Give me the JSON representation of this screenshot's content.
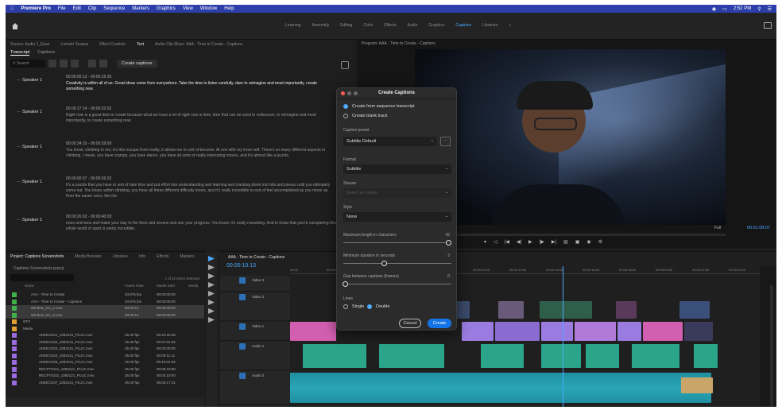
{
  "menubar": {
    "app": "Premiere Pro",
    "items": [
      "File",
      "Edit",
      "Clip",
      "Sequence",
      "Markers",
      "Graphics",
      "View",
      "Window",
      "Help"
    ],
    "clock": "2:52 PM"
  },
  "workspaces": {
    "tabs": [
      "Learning",
      "Assembly",
      "Editing",
      "Color",
      "Effects",
      "Audio",
      "Graphics",
      "Captions",
      "Libraries"
    ],
    "active": "Captions"
  },
  "left_panel": {
    "tabs": [
      "Source: Audio 1_Ease",
      "Lumetri Scopes",
      "Effect Controls",
      "Text",
      "Audio Clip Mixer: AAA - Time to Create - Captions"
    ],
    "active_tab": "Text",
    "subtabs": [
      "Transcript",
      "Captions"
    ],
    "active_subtab": "Transcript",
    "search_placeholder": "Search",
    "create_captions_label": "Create captions",
    "transcript": [
      {
        "speaker": "Speaker 1",
        "timecode": "00:00:00:13 - 00:00:15:20",
        "text": "Creativity is within all of us. Great ideas come from everywhere. Take the time to listen carefully, dare to reimagine and most importantly, create something new.",
        "highlight": true
      },
      {
        "speaker": "Speaker 1",
        "timecode": "00:00:17:14 - 00:00:32:02",
        "text": "Right now is a great time to create because what we have a lot of right now is time; time that can be used to rediscover, to reimagine and most importantly, to create something new.",
        "highlight": false
      },
      {
        "speaker": "Speaker 1",
        "timecode": "00:00:34:10 - 00:00:39:09",
        "text": "You know, climbing to me, it's this escape from reality, it allows me to sort of become. At one with my inner self. There's so many different aspects to climbing. I mean, you have cramps, you have dance, you have all sorts of really interesting moves, and it's almost like a puzzle.",
        "highlight": false
      },
      {
        "speaker": "Speaker 1",
        "timecode": "00:00:00:07 - 00:00:26:02",
        "text": "It's a puzzle that you have to sort of take time and put effort into understanding and learning and cracking down into bits and pieces until you ultimately come out. You know, within climbing, you have all these different difficulty levels, and it's really incredible to sort of feel accomplished as you move up from the easier ones, like the",
        "highlight": false
      },
      {
        "speaker": "Speaker 1",
        "timecode": "00:00:26:02 - 00:00:40:03",
        "text": "ones and twos and make your way to the fives and sevens and see your progress. You know, it's really rewarding. And to know that you're conquering this whole world of sport is pretty incredible.",
        "highlight": false
      }
    ]
  },
  "program": {
    "title": "Program: AAA - Time to Create - Captions",
    "fit": "Full",
    "timecode": "00:01:08:07"
  },
  "dialog": {
    "title": "Create Captions",
    "source_options": [
      {
        "label": "Create from sequence transcript",
        "selected": true
      },
      {
        "label": "Create blank track",
        "selected": false
      }
    ],
    "caption_preset_label": "Caption preset",
    "caption_preset_value": "Subtitle Default",
    "format_label": "Format",
    "format_value": "Subtitle",
    "stream_label": "Stream",
    "stream_value": "Select an option",
    "style_label": "Style",
    "style_value": "None",
    "max_length_label": "Maximum length in characters",
    "max_length_value": "42",
    "min_duration_label": "Minimum duration in seconds",
    "min_duration_value": "3",
    "gap_label": "Gap between captions (frames)",
    "gap_value": "0",
    "lines_label": "Lines",
    "lines_options": [
      {
        "label": "Single",
        "selected": false
      },
      {
        "label": "Double",
        "selected": true
      }
    ],
    "cancel_label": "Cancel",
    "create_label": "Create"
  },
  "project": {
    "tabs": [
      "Project: Captions Screenshots",
      "Media Browser",
      "Libraries",
      "Info",
      "Effects",
      "Markers"
    ],
    "file": "Captions Screenshots.prproj",
    "items_count": "1 of 11 items selected",
    "columns": [
      "Name",
      "Frame Rate",
      "Media Start",
      "Media"
    ],
    "rows": [
      {
        "name": "AAA - Time to Create",
        "fr": "23.976 fps",
        "start": "00:00:00:00",
        "color": "#3fb04a",
        "indent": 1,
        "selected": false
      },
      {
        "name": "AAA - Time to Create - Captions",
        "fr": "23.976 fps",
        "start": "00:00:00:00",
        "color": "#3fb04a",
        "indent": 1,
        "selected": false
      },
      {
        "name": "Window_KC_1.mov",
        "fr": "00:00:10",
        "start": "00:00:00:00",
        "color": "#3fb04a",
        "indent": 1,
        "selected": true
      },
      {
        "name": "Window_KC_2.mov",
        "fr": "00:00:10",
        "start": "00:00:00:00",
        "color": "#3fb04a",
        "indent": 1,
        "selected": true
      },
      {
        "name": "GFX",
        "fr": "",
        "start": "",
        "color": "#e0a030",
        "indent": 0,
        "selected": false
      },
      {
        "name": "Media",
        "fr": "",
        "start": "",
        "color": "#e0a030",
        "indent": 0,
        "selected": false
      },
      {
        "name": "ADMC0101_1083121_PLUC.mov",
        "fr": "25.00 fps",
        "start": "00:23:16:08",
        "color": "#9a6be0",
        "indent": 2,
        "selected": false
      },
      {
        "name": "ADMC0102_1083121_PLUC.mov",
        "fr": "25.00 fps",
        "start": "00:47:01:02",
        "color": "#9a6be0",
        "indent": 2,
        "selected": false
      },
      {
        "name": "ADMC0103_1083121_PLUC.mov",
        "fr": "25.00 fps",
        "start": "00:00:00:00",
        "color": "#9a6be0",
        "indent": 2,
        "selected": false
      },
      {
        "name": "ADMC0104_1083121_PLUC.mov",
        "fr": "25.00 fps",
        "start": "00:09:11:11",
        "color": "#9a6be0",
        "indent": 2,
        "selected": false
      },
      {
        "name": "ADMC0105_1083121_PLUC.mov",
        "fr": "25.00 fps",
        "start": "00:10:04:02",
        "color": "#9a6be0",
        "indent": 2,
        "selected": false
      },
      {
        "name": "RECPT0101_1083121_PLUC.mov",
        "fr": "25.00 fps",
        "start": "00:06:19:08",
        "color": "#9a6be0",
        "indent": 2,
        "selected": false
      },
      {
        "name": "RECPT0102_1083121_PLUC.mov",
        "fr": "25.00 fps",
        "start": "00:04:10:00",
        "color": "#9a6be0",
        "indent": 2,
        "selected": false
      },
      {
        "name": "ADMC0107_1083121_PLUC.mov",
        "fr": "25.00 fps",
        "start": "00:05:17:21",
        "color": "#9a6be0",
        "indent": 2,
        "selected": false
      }
    ]
  },
  "timeline": {
    "title": "AAA - Time to Create - Captions",
    "timecode": "00:00:10:13",
    "ruler": [
      "00:00",
      "00:00:02:00",
      "00:00:04:00",
      "00:00:06:00",
      "00:00:08:00",
      "00:00:10:00",
      "00:00:12:00",
      "00:00:14:00",
      "00:00:16:00",
      "00:00:18:00",
      "00:00:20:00",
      "00:00:22:00",
      "00:00:24:00"
    ],
    "tracks": [
      {
        "name": "Video 3"
      },
      {
        "name": "Video 2"
      },
      {
        "name": "Video 1"
      },
      {
        "name": "Audio 1"
      },
      {
        "name": "Audio 2"
      }
    ]
  },
  "colors": {
    "accent": "#1473e6",
    "timecode": "#4aa8ff",
    "menubar": "#2c3fa8",
    "audio_clip": "#2aa58a",
    "video_clip_pink": "#d35fb0",
    "video_clip_purple": "#9a7be0"
  }
}
